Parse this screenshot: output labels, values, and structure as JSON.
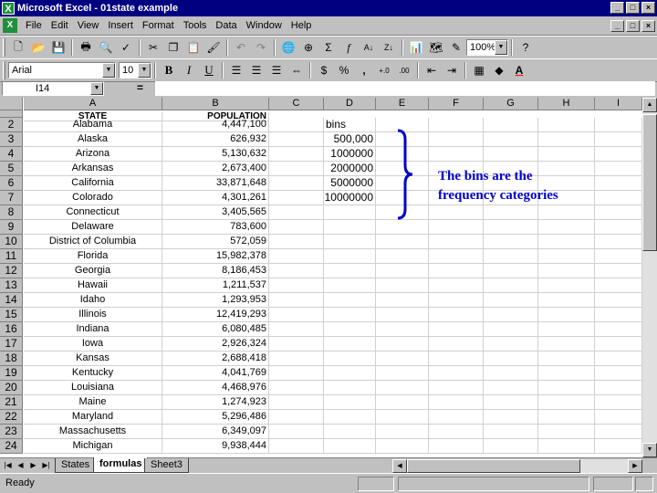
{
  "window": {
    "title": "Microsoft Excel - 01state example",
    "app_icon": "excel-icon",
    "doc_icon": "excel-doc-icon",
    "controls": {
      "minimize": "_",
      "maximize": "□",
      "close": "×"
    }
  },
  "menu": [
    "File",
    "Edit",
    "View",
    "Insert",
    "Format",
    "Tools",
    "Data",
    "Window",
    "Help"
  ],
  "toolbar": {
    "zoom": "100%",
    "font": "Arial",
    "font_size": "10"
  },
  "formula_bar": {
    "name_box": "I14",
    "equals": "=",
    "content": ""
  },
  "columns": [
    "A",
    "B",
    "C",
    "D",
    "E",
    "F",
    "G",
    "H",
    "I"
  ],
  "rows": {
    "header_row_label": "",
    "numbers": [
      "2",
      "3",
      "4",
      "5",
      "6",
      "7",
      "8",
      "9",
      "10",
      "11",
      "12",
      "13",
      "14",
      "15",
      "16",
      "17",
      "18",
      "19",
      "20",
      "21",
      "22",
      "23",
      "24"
    ]
  },
  "table": {
    "header": {
      "state": "STATE",
      "population": "POPULATION"
    },
    "data": [
      [
        "Alabama",
        "4,447,100"
      ],
      [
        "Alaska",
        "626,932"
      ],
      [
        "Arizona",
        "5,130,632"
      ],
      [
        "Arkansas",
        "2,673,400"
      ],
      [
        "California",
        "33,871,648"
      ],
      [
        "Colorado",
        "4,301,261"
      ],
      [
        "Connecticut",
        "3,405,565"
      ],
      [
        "Delaware",
        "783,600"
      ],
      [
        "District of Columbia",
        "572,059"
      ],
      [
        "Florida",
        "15,982,378"
      ],
      [
        "Georgia",
        "8,186,453"
      ],
      [
        "Hawaii",
        "1,211,537"
      ],
      [
        "Idaho",
        "1,293,953"
      ],
      [
        "Illinois",
        "12,419,293"
      ],
      [
        "Indiana",
        "6,080,485"
      ],
      [
        "Iowa",
        "2,926,324"
      ],
      [
        "Kansas",
        "2,688,418"
      ],
      [
        "Kentucky",
        "4,041,769"
      ],
      [
        "Louisiana",
        "4,468,976"
      ],
      [
        "Maine",
        "1,274,923"
      ],
      [
        "Maryland",
        "5,296,486"
      ],
      [
        "Massachusetts",
        "6,349,097"
      ],
      [
        "Michigan",
        "9,938,444"
      ]
    ]
  },
  "bins": {
    "label": "bins",
    "values": [
      "500,000",
      "1000000",
      "2000000",
      "5000000",
      "10000000"
    ]
  },
  "sheets": {
    "tabs": [
      "States",
      "formulas",
      "Sheet3"
    ],
    "active": "formulas"
  },
  "status": {
    "text": "Ready"
  },
  "annotation": {
    "line1": "The bins are the",
    "line2": "frequency categories",
    "color": "#0000cc"
  }
}
